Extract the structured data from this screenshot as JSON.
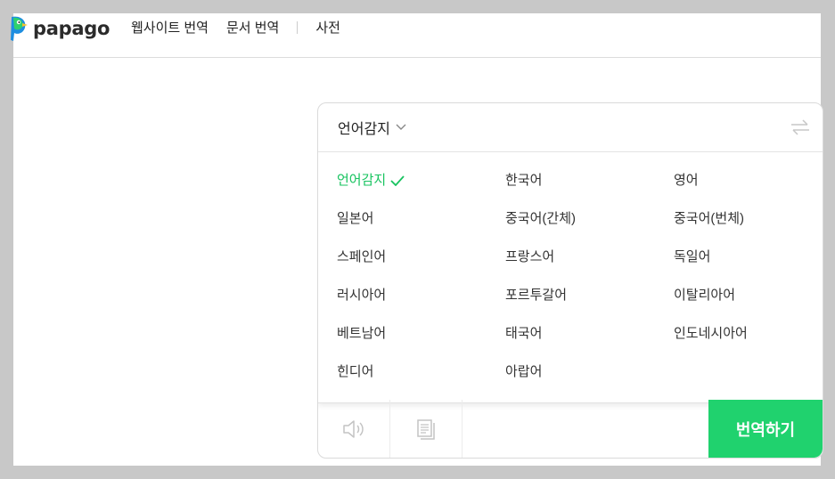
{
  "brand": {
    "name": "papago",
    "colors": {
      "accent": "#20d26e",
      "selected": "#17c35f",
      "logo_blue": "#1e8ee0",
      "logo_green": "#2fd16d",
      "logo_yellow": "#f2c12e"
    }
  },
  "nav": {
    "items": [
      {
        "label": "웹사이트 번역"
      },
      {
        "label": "문서 번역"
      },
      {
        "label": "사전"
      }
    ]
  },
  "source": {
    "selected_label": "언어감지",
    "icons": {
      "dropdown": "chevron-down-icon",
      "swap": "swap-icon"
    }
  },
  "languages": {
    "rows": [
      [
        "언어감지",
        "한국어",
        "영어"
      ],
      [
        "일본어",
        "중국어(간체)",
        "중국어(번체)"
      ],
      [
        "스페인어",
        "프랑스어",
        "독일어"
      ],
      [
        "러시아어",
        "포르투갈어",
        "이탈리아어"
      ],
      [
        "베트남어",
        "태국어",
        "인도네시아어"
      ],
      [
        "힌디어",
        "아랍어",
        ""
      ]
    ],
    "selected": "언어감지"
  },
  "toolbar": {
    "icons": {
      "speaker": "speaker-icon",
      "document": "document-icon"
    },
    "translate_label": "번역하기"
  }
}
